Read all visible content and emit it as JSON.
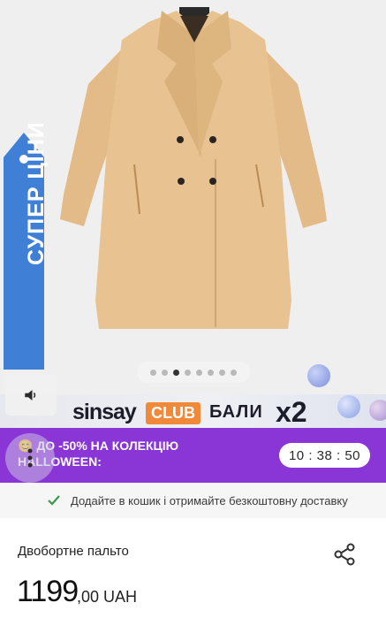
{
  "hero": {
    "carousel": {
      "total_slides": 8,
      "active_slide": 2
    },
    "price_tag": {
      "label": "СУПЕР ЦІНИ"
    }
  },
  "club_banner": {
    "brand": "sinsay",
    "club": "CLUB",
    "bali": "БАЛИ",
    "multiplier": "x2"
  },
  "promo": {
    "emoji": "😊",
    "line1": "ДО -50% НА КОЛЕКЦІЮ",
    "line2": "HALLOWEEN:",
    "timer": "10 : 38 : 50"
  },
  "shipping": {
    "text": "Додайте в кошик і отримайте безкоштовну доставку"
  },
  "product": {
    "name": "Двобортне пальто",
    "price_whole": "1199",
    "price_fraction": ",00 UAH"
  },
  "colors": {
    "coat": "#e6c08f",
    "promo_bg": "#8a35d6",
    "club_orange": "#f08a3a",
    "price_tag_blue": "#3f7fd6",
    "check_green": "#3a9a4a"
  },
  "icons": [
    "check-icon",
    "share-icon",
    "speaker-icon",
    "more-vertical-icon",
    "price-tag-icon"
  ]
}
